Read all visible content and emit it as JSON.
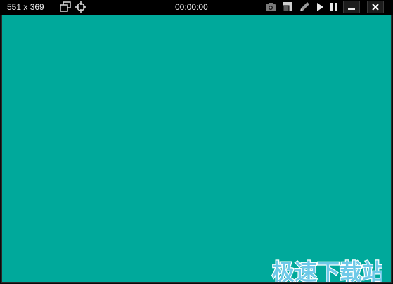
{
  "toolbar": {
    "size_label": "551 x 369",
    "timer": "00:00:00",
    "icons": {
      "region": "region-select-icon",
      "crosshair": "crosshair-icon",
      "camera": "camera-icon",
      "pip": "picture-in-picture-icon",
      "pencil": "pencil-icon",
      "play": "play-icon",
      "pause": "pause-icon",
      "minimize": "minimize-icon",
      "close": "close-icon"
    }
  },
  "canvas": {
    "background": "#00a99b"
  },
  "watermark": {
    "text": "极速下载站"
  }
}
